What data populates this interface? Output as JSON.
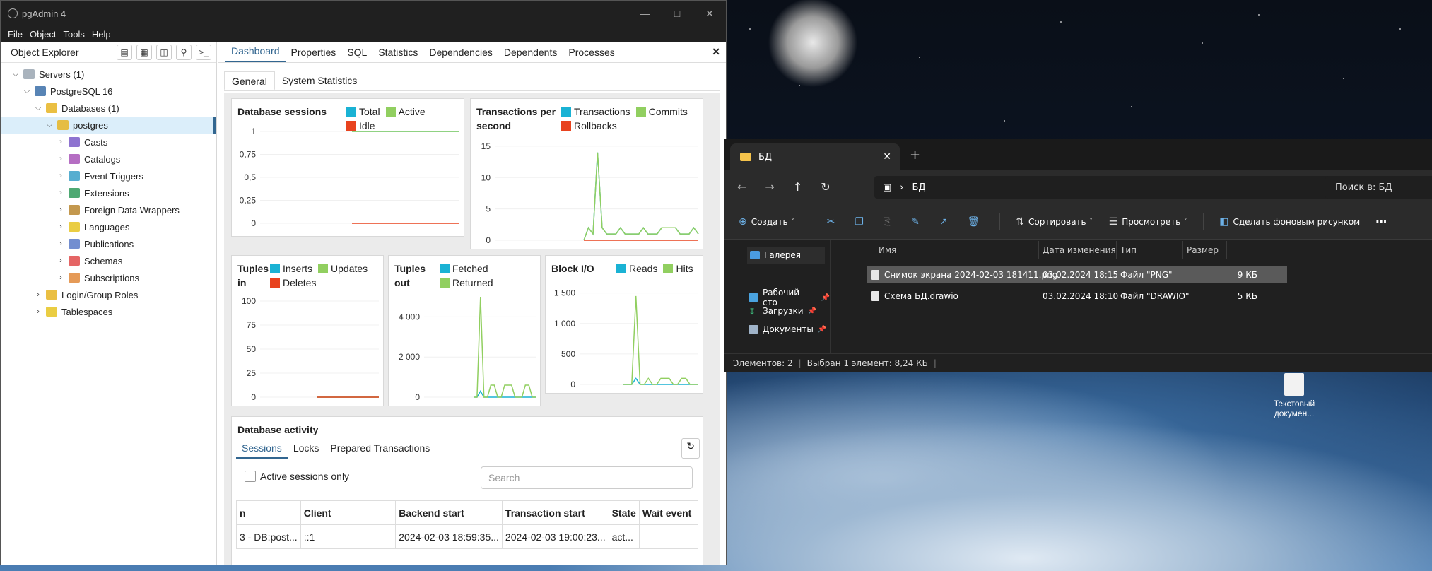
{
  "desktop": {
    "icon_label": "Текстовый докумен..."
  },
  "pgadmin": {
    "title": "pgAdmin 4",
    "menu": [
      "File",
      "Object",
      "Tools",
      "Help"
    ],
    "explorer": {
      "title": "Object Explorer",
      "tree": [
        {
          "label": "Servers (1)",
          "icon": "servers-icon"
        },
        {
          "label": "PostgreSQL 16",
          "icon": "elephant-icon"
        },
        {
          "label": "Databases (1)",
          "icon": "databases-icon"
        },
        {
          "label": "postgres",
          "icon": "database-icon"
        },
        {
          "label": "Casts",
          "icon": "casts-icon"
        },
        {
          "label": "Catalogs",
          "icon": "catalogs-icon"
        },
        {
          "label": "Event Triggers",
          "icon": "event-triggers-icon"
        },
        {
          "label": "Extensions",
          "icon": "extensions-icon"
        },
        {
          "label": "Foreign Data Wrappers",
          "icon": "fdw-icon"
        },
        {
          "label": "Languages",
          "icon": "languages-icon"
        },
        {
          "label": "Publications",
          "icon": "publications-icon"
        },
        {
          "label": "Schemas",
          "icon": "schemas-icon"
        },
        {
          "label": "Subscriptions",
          "icon": "subscriptions-icon"
        },
        {
          "label": "Login/Group Roles",
          "icon": "roles-icon"
        },
        {
          "label": "Tablespaces",
          "icon": "tablespaces-icon"
        }
      ]
    },
    "tabs": [
      "Dashboard",
      "Properties",
      "SQL",
      "Statistics",
      "Dependencies",
      "Dependents",
      "Processes"
    ],
    "subtabs": [
      "General",
      "System Statistics"
    ],
    "colors": {
      "blue": "#1ab2d4",
      "green": "#91cf60",
      "red": "#e8431f",
      "accent": "#326690"
    },
    "panels": {
      "sessions": {
        "title": "Database sessions",
        "legend": [
          "Total",
          "Active",
          "Idle"
        ],
        "yticks": [
          "1",
          "0,75",
          "0,5",
          "0,25",
          "0"
        ]
      },
      "transactions": {
        "title": "Transactions per second",
        "legend": [
          "Transactions",
          "Commits",
          "Rollbacks"
        ],
        "yticks": [
          "15",
          "10",
          "5",
          "0"
        ]
      },
      "tuples_in": {
        "title": "Tuples in",
        "legend": [
          "Inserts",
          "Updates",
          "Deletes"
        ],
        "yticks": [
          "100",
          "75",
          "50",
          "25",
          "0"
        ]
      },
      "tuples_out": {
        "title": "Tuples out",
        "legend": [
          "Fetched",
          "Returned"
        ],
        "yticks": [
          "4 000",
          "2 000",
          "0"
        ]
      },
      "block_io": {
        "title": "Block I/O",
        "legend": [
          "Reads",
          "Hits"
        ],
        "yticks": [
          "1 500",
          "1 000",
          "500",
          "0"
        ]
      }
    },
    "activity": {
      "title": "Database activity",
      "tabs": [
        "Sessions",
        "Locks",
        "Prepared Transactions"
      ],
      "checkbox_label": "Active sessions only",
      "search_placeholder": "Search",
      "columns": [
        "n",
        "Client",
        "Backend start",
        "Transaction start",
        "State",
        "Wait event"
      ],
      "rows": [
        [
          "3 - DB:post...",
          "::1",
          "2024-02-03 18:59:35...",
          "2024-02-03 19:00:23...",
          "act...",
          ""
        ]
      ]
    }
  },
  "explorer_win": {
    "tab_title": "БД",
    "path": "БД",
    "search": "Поиск в: БД",
    "commands": {
      "create": "Создать",
      "sort": "Сортировать",
      "view": "Просмотреть",
      "wallpaper": "Сделать фоновым рисунком"
    },
    "sidebar": [
      "Галерея",
      "Рабочий сто",
      "Загрузки",
      "Документы"
    ],
    "columns": [
      "Имя",
      "Дата изменения",
      "Тип",
      "Размер"
    ],
    "files": [
      {
        "name": "Снимок экрана 2024-02-03 181411.png",
        "date": "03.02.2024 18:15",
        "type": "Файл \"PNG\"",
        "size": "9 КБ"
      },
      {
        "name": "Схема БД.drawio",
        "date": "03.02.2024 18:10",
        "type": "Файл \"DRAWIO\"",
        "size": "5 КБ"
      }
    ],
    "status_count": "Элементов: 2",
    "status_selected": "Выбран 1 элемент: 8,24 КБ"
  },
  "chart_data": [
    {
      "type": "line",
      "title": "Database sessions",
      "ylim": [
        0,
        1
      ],
      "x": [
        0,
        1,
        2,
        3,
        4,
        5,
        6,
        7,
        8,
        9
      ],
      "series": [
        {
          "name": "Total",
          "values": [
            1,
            1,
            1,
            1,
            1,
            1,
            1,
            1,
            1,
            1
          ]
        },
        {
          "name": "Active",
          "values": [
            1,
            1,
            1,
            1,
            1,
            1,
            1,
            1,
            1,
            1
          ]
        },
        {
          "name": "Idle",
          "values": [
            0,
            0,
            0,
            0,
            0,
            0,
            0,
            0,
            0,
            0
          ]
        }
      ]
    },
    {
      "type": "line",
      "title": "Transactions per second",
      "ylim": [
        0,
        16
      ],
      "x": [
        0,
        1,
        2,
        3,
        4,
        5,
        6,
        7,
        8,
        9,
        10,
        11,
        12,
        13,
        14,
        15,
        16,
        17,
        18,
        19,
        20,
        21,
        22,
        23,
        24,
        25
      ],
      "series": [
        {
          "name": "Transactions",
          "values": [
            0,
            2,
            1,
            14,
            2,
            1,
            1,
            1,
            2,
            1,
            1,
            1,
            1,
            2,
            1,
            1,
            1,
            2,
            2,
            2,
            2,
            1,
            1,
            1,
            2,
            1
          ]
        },
        {
          "name": "Commits",
          "values": [
            0,
            2,
            1,
            14,
            2,
            1,
            1,
            1,
            2,
            1,
            1,
            1,
            1,
            2,
            1,
            1,
            1,
            2,
            2,
            2,
            2,
            1,
            1,
            1,
            2,
            1
          ]
        },
        {
          "name": "Rollbacks",
          "values": [
            0,
            0,
            0,
            0,
            0,
            0,
            0,
            0,
            0,
            0,
            0,
            0,
            0,
            0,
            0,
            0,
            0,
            0,
            0,
            0,
            0,
            0,
            0,
            0,
            0,
            0
          ]
        }
      ]
    },
    {
      "type": "line",
      "title": "Tuples in",
      "ylim": [
        0,
        100
      ],
      "x": [
        0,
        1,
        2,
        3,
        4,
        5,
        6,
        7,
        8,
        9
      ],
      "series": [
        {
          "name": "Inserts",
          "values": [
            0,
            0,
            0,
            0,
            0,
            0,
            0,
            0,
            0,
            0
          ]
        },
        {
          "name": "Updates",
          "values": [
            0,
            0,
            0,
            0,
            0,
            0,
            0,
            0,
            0,
            0
          ]
        },
        {
          "name": "Deletes",
          "values": [
            0,
            0,
            0,
            0,
            0,
            0,
            0,
            0,
            0,
            0
          ]
        }
      ]
    },
    {
      "type": "line",
      "title": "Tuples out",
      "ylim": [
        0,
        5000
      ],
      "x": [
        0,
        1,
        2,
        3,
        4,
        5,
        6,
        7,
        8,
        9,
        10,
        11,
        12,
        13,
        14,
        15,
        16,
        17,
        18
      ],
      "series": [
        {
          "name": "Fetched",
          "values": [
            0,
            0,
            300,
            0,
            0,
            0,
            0,
            0,
            0,
            0,
            0,
            0,
            0,
            0,
            0,
            0,
            0,
            0,
            0
          ]
        },
        {
          "name": "Returned",
          "values": [
            0,
            0,
            5000,
            0,
            0,
            600,
            600,
            0,
            0,
            600,
            600,
            600,
            0,
            0,
            0,
            600,
            600,
            0,
            0
          ]
        }
      ]
    },
    {
      "type": "line",
      "title": "Block I/O",
      "ylim": [
        0,
        1600
      ],
      "x": [
        0,
        1,
        2,
        3,
        4,
        5,
        6,
        7,
        8,
        9,
        10,
        11,
        12,
        13,
        14,
        15,
        16,
        17,
        18
      ],
      "series": [
        {
          "name": "Reads",
          "values": [
            0,
            0,
            0,
            100,
            0,
            0,
            0,
            0,
            0,
            0,
            0,
            0,
            0,
            0,
            0,
            0,
            0,
            0,
            0
          ]
        },
        {
          "name": "Hits",
          "values": [
            0,
            0,
            0,
            1450,
            0,
            0,
            100,
            0,
            0,
            100,
            100,
            100,
            0,
            0,
            100,
            100,
            0,
            0,
            0
          ]
        }
      ]
    }
  ]
}
